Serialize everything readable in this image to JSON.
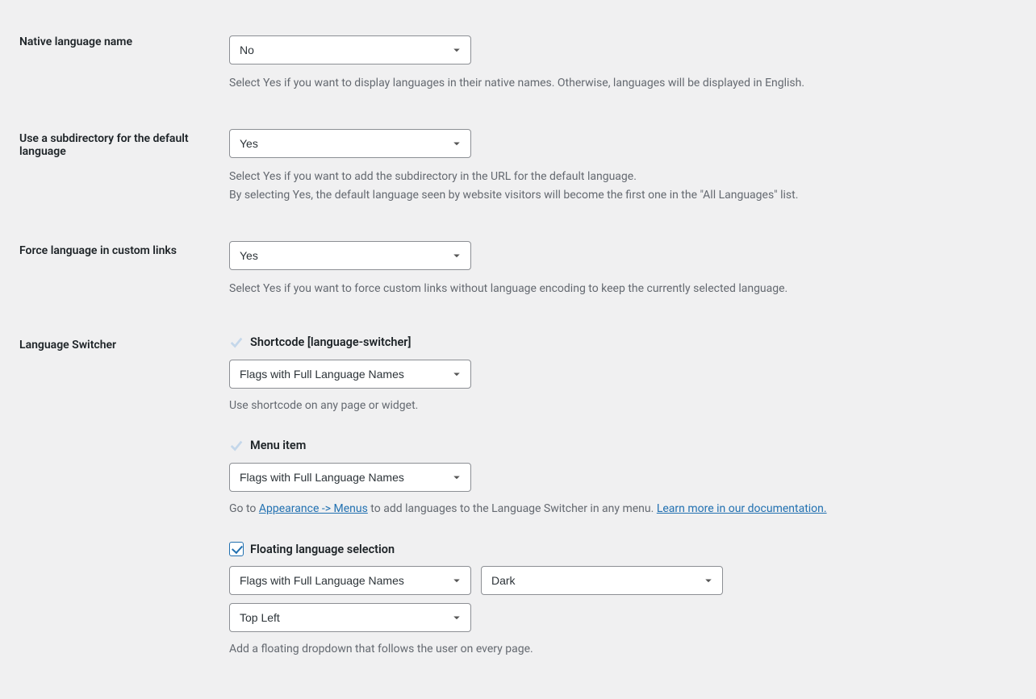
{
  "settings": {
    "native_language_name": {
      "label": "Native language name",
      "value": "No",
      "description": "Select Yes if you want to display languages in their native names. Otherwise, languages will be displayed in English."
    },
    "subdirectory_default": {
      "label": "Use a subdirectory for the default language",
      "value": "Yes",
      "description_line1": "Select Yes if you want to add the subdirectory in the URL for the default language.",
      "description_line2": "By selecting Yes, the default language seen by website visitors will become the first one in the \"All Languages\" list."
    },
    "force_language_custom_links": {
      "label": "Force language in custom links",
      "value": "Yes",
      "description": "Select Yes if you want to force custom links without language encoding to keep the currently selected language."
    },
    "language_switcher": {
      "label": "Language Switcher",
      "shortcode": {
        "title": "Shortcode [language-switcher]",
        "value": "Flags with Full Language Names",
        "description": "Use shortcode on any page or widget."
      },
      "menu_item": {
        "title": "Menu item",
        "value": "Flags with Full Language Names",
        "description_pre": "Go to ",
        "link1": "Appearance -> Menus",
        "description_mid": " to add languages to the Language Switcher in any menu. ",
        "link2": "Learn more in our documentation."
      },
      "floating": {
        "title": "Floating language selection",
        "display_value": "Flags with Full Language Names",
        "theme_value": "Dark",
        "position_value": "Top Left",
        "description": "Add a floating dropdown that follows the user on every page."
      }
    }
  }
}
